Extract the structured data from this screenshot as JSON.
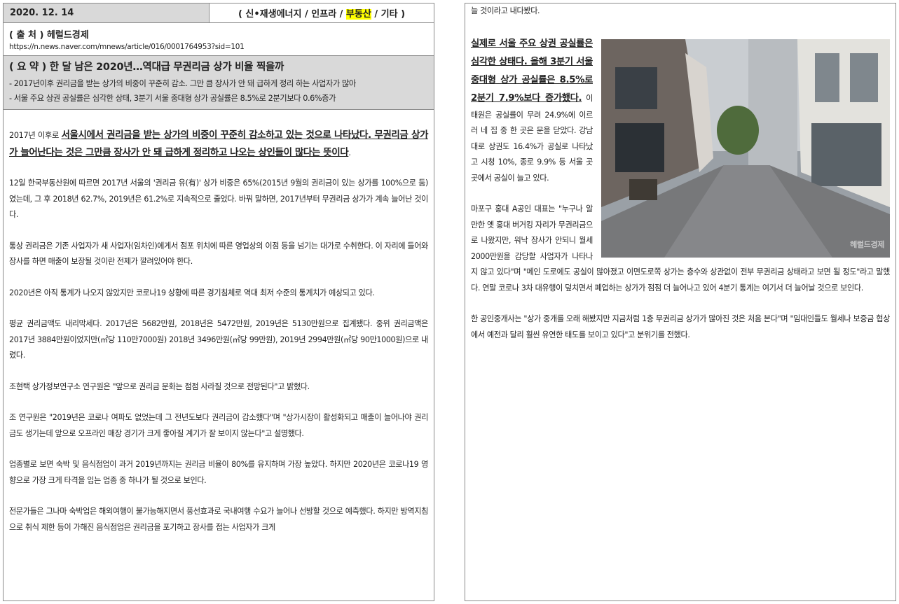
{
  "header": {
    "date": "2020. 12. 14",
    "category_prefix": "( 신•재생에너지 / 인프라 / ",
    "category_highlight": "부동산",
    "category_suffix": " / 기타 )"
  },
  "source": {
    "title": "( 출 처 ) 헤럴드경제",
    "url": "https://n.news.naver.com/mnews/article/016/0001764953?sid=101"
  },
  "summary": {
    "title": "( 요 약 ) 한 달 남은 2020년…역대급 무권리금 상가 비율 찍을까",
    "line1": "- 2017년이후 권리금을 받는 상가의 비중이 꾸준히 감소. 그만 큼 장사가 안 돼 급하게 정리 하는 사업자가 많아",
    "line2": "- 서울 주요 상권 공실률은 심각한 상태, 3분기 서울 중대형 상가 공실률은 8.5%로 2분기보다 0.6%증가"
  },
  "left_body": {
    "lead_prefix": "2017년 이후로 ",
    "lead_bold": "서울시에서 권리금을 받는 상가의 비중이 꾸준히 감소하고 있는 것으로 나타났다. 무권리금 상가가 늘어난다는 것은 그만큼 장사가 안 돼 급하게 정리하고 나오는 상인들이 많다는 뜻이다",
    "lead_suffix": ".",
    "p1": "12일 한국부동산원에 따르면 2017년 서울의 '권리금 유(有)' 상가 비중은 65%(2015년 9월의 권리금이 있는 상가를 100%으로 둠)였는데, 그 후 2018년 62.7%, 2019년은 61.2%로 지속적으로 줄었다. 바꿔 말하면, 2017년부터 무권리금 상가가 계속 늘어난 것이다.",
    "p2": "통상 권리금은 기존 사업자가 새 사업자(임차인)에게서 점포 위치에 따른 영업상의 이점 등을 넘기는 대가로 수취한다. 이 자리에 들어와 장사를 하면 매출이 보장될 것이란 전제가 깔려있어야 한다.",
    "p3": "2020년은 아직 통계가 나오지 않았지만 코로나19 상황에 따른 경기침체로 역대 최저 수준의 통계치가 예상되고 있다.",
    "p4": "평균 권리금액도 내리막세다. 2017년은 5682만원, 2018년은 5472만원, 2019년은 5130만원으로 집계됐다. 중위 권리금액은 2017년 3884만원이었지만(㎡당 110만7000원) 2018년 3496만원(㎡당 99만원), 2019년 2994만원(㎡당 90만1000원)으로 내렸다.",
    "p5": "조현택 상가정보연구소 연구원은 \"앞으로 권리금 문화는 점점 사라질 것으로 전망된다\"고 밝혔다.",
    "p6": "조 연구원은 \"2019년은 코로나 여파도 없었는데 그 전년도보다 권리금이 감소했다\"며 \"상가시장이 활성화되고 매출이 늘어나야 권리금도 생기는데 앞으로 오프라인 매장 경기가 크게 좋아질 계기가 잘 보이지 않는다\"고 설명했다.",
    "p7": "업종별로 보면 숙박 및 음식점업이 과거 2019년까지는 권리금 비율이 80%를 유지하며 가장 높았다. 하지만 2020년은 코로나19 영향으로 가장 크게 타격을 입는 업종 중 하나가 될 것으로 보인다.",
    "p8": "전문가들은 그나마 숙박업은 해외여행이 불가능해지면서 풍선효과로 국내여행 수요가 늘어나 선방할 것으로 예측했다. 하지만 방역지침으로 취식 제한 등이 가해진 음식점업은 권리금을 포기하고 장사를 접는 사업자가 크게"
  },
  "right_body": {
    "top": "늘 것이라고 내다봤다.",
    "p1_bold": "실제로 서울 주요 상권 공실률은 심각한 상태다. 올해 3분기 서울 중대형 상가 공실률은 8.5%로 2분기 7.9%보다 증가했다.",
    "p1_rest": " 이태원은 공실률이 무려 24.9%에 이르러 네 집 중 한 곳은 문을 닫았다. 강남대로 상권도 16.4%가 공실로 나타났고 시청 10%, 종로 9.9% 등 서울 곳곳에서 공실이 늘고 있다.",
    "p2": "마포구 홍대 A공인 대표는 \"누구나 알만한 옛 홍대 버거킹 자리가 무권리금으로 나왔지만, 워낙 장사가 안되니 월세 2000만원을 감당할 사업자가 나타나지 않고 있다\"며 \"메인 도로에도 공실이 많아졌고 이면도로쪽 상가는 층수와 상관없이 전부 무권리금 상태라고 보면 될 정도\"라고 말했다. 연말 코로나 3차 대유행이 덮치면서 폐업하는 상가가 점점 더 늘어나고 있어 4분기 통계는 여기서 더 늘어날 것으로 보인다.",
    "p3": "한 공인중개사는 \"상가 중개를 오래 해봤지만 지금처럼 1층 무권리금 상가가 많아진 것은 처음 본다\"며 \"임대인들도 월세나 보증금 협상에서 예전과 달리 훨씬 유연한 태도를 보이고 있다\"고 분위기를 전했다.",
    "watermark": "헤럴드경제"
  }
}
